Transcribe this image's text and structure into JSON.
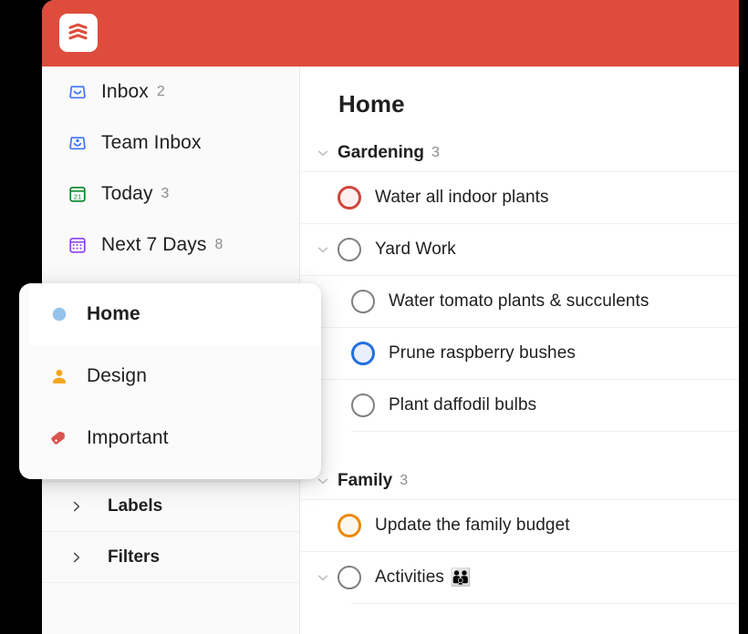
{
  "app": {
    "logo_icon": "todoist-logo-icon",
    "header_color": "#de4c3c"
  },
  "sidebar": {
    "items": [
      {
        "label": "Inbox",
        "count": "2",
        "icon": "inbox-icon",
        "icon_color": "#4073ff"
      },
      {
        "label": "Team Inbox",
        "count": "",
        "icon": "team-inbox-icon",
        "icon_color": "#4073ff"
      },
      {
        "label": "Today",
        "count": "3",
        "icon": "calendar-today-icon",
        "icon_color": "#058527"
      },
      {
        "label": "Next 7 Days",
        "count": "8",
        "icon": "calendar-week-icon",
        "icon_color": "#8f3df0"
      }
    ],
    "collapsibles": [
      {
        "label": "Labels",
        "icon": "chevron-right-icon"
      },
      {
        "label": "Filters",
        "icon": "chevron-right-icon"
      }
    ]
  },
  "project_popup": {
    "items": [
      {
        "label": "Home",
        "icon": "dot-icon",
        "icon_color": "#96c3eb",
        "active": true
      },
      {
        "label": "Design",
        "icon": "person-icon",
        "icon_color": "#f5a623",
        "active": false
      },
      {
        "label": "Important",
        "icon": "tag-icon",
        "icon_color": "#d9534f",
        "active": false
      }
    ]
  },
  "main": {
    "title": "Home",
    "sections": [
      {
        "name": "Gardening",
        "count": "3",
        "chevron": "chevron-down-icon",
        "tasks": [
          {
            "text": "Water all indoor plants",
            "priority": "p1",
            "indent": false,
            "chevron": false,
            "emoji": ""
          },
          {
            "text": "Yard Work",
            "priority": "p4",
            "indent": false,
            "chevron": true,
            "emoji": ""
          },
          {
            "text": "Water tomato plants & succulents",
            "priority": "p4",
            "indent": true,
            "chevron": false,
            "emoji": ""
          },
          {
            "text": "Prune raspberry bushes",
            "priority": "p3",
            "indent": true,
            "chevron": false,
            "emoji": ""
          },
          {
            "text": "Plant daffodil bulbs",
            "priority": "p4",
            "indent": true,
            "chevron": false,
            "emoji": ""
          }
        ]
      },
      {
        "name": "Family",
        "count": "3",
        "chevron": "chevron-down-icon",
        "tasks": [
          {
            "text": "Update the family budget",
            "priority": "p2",
            "indent": false,
            "chevron": false,
            "emoji": ""
          },
          {
            "text": "Activities",
            "priority": "p4",
            "indent": false,
            "chevron": true,
            "emoji": "👪"
          }
        ]
      }
    ]
  }
}
